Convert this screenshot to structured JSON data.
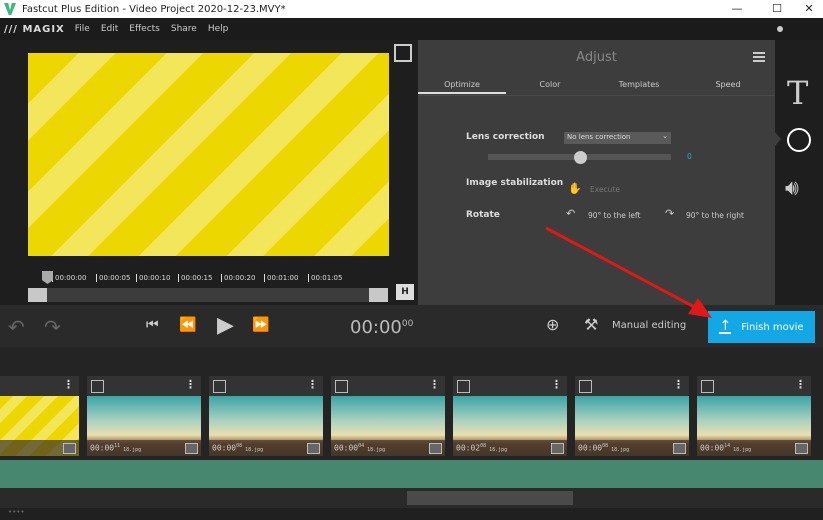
{
  "window": {
    "title": "Fastcut Plus Edition - Video Project 2020-12-23.MVY*",
    "minimize": "—",
    "maximize": "☐",
    "close": "✕"
  },
  "menu": {
    "brand": "/// MAGIX",
    "items": [
      "File",
      "Edit",
      "Effects",
      "Share",
      "Help"
    ]
  },
  "preview": {
    "ruler": [
      "00:00:00",
      "00:00:05",
      "00:00:10",
      "00:00:15",
      "00:00:20",
      "00:01:00",
      "00:01:05"
    ]
  },
  "adjust": {
    "title": "Adjust",
    "tabs": [
      "Optimize",
      "Color",
      "Templates",
      "Speed"
    ],
    "active_tab": "Optimize",
    "lens_label": "Lens correction",
    "lens_value": "No lens correction",
    "slider_value": "0",
    "slider_fraction": 0.5,
    "stab_label": "Image stabilization",
    "execute": "Execute",
    "rotate_label": "Rotate",
    "rotate_left": "90° to the left",
    "rotate_right": "90° to the right"
  },
  "transport": {
    "time": "00:00",
    "time_frames": "00",
    "manual_editing": "Manual editing",
    "finish_movie": "Finish movie"
  },
  "clips": [
    {
      "time": "",
      "frames": "",
      "file": "6.jpg"
    },
    {
      "time": "00:00",
      "frames": "11",
      "file": "18.jpg"
    },
    {
      "time": "00:00",
      "frames": "08",
      "file": "18.jpg"
    },
    {
      "time": "00:00",
      "frames": "04",
      "file": "18.jpg"
    },
    {
      "time": "00:02",
      "frames": "08",
      "file": "18.jpg"
    },
    {
      "time": "00:00",
      "frames": "08",
      "file": "18.jpg"
    },
    {
      "time": "00:00",
      "frames": "14",
      "file": "18.jpg"
    }
  ],
  "footer": "••••"
}
